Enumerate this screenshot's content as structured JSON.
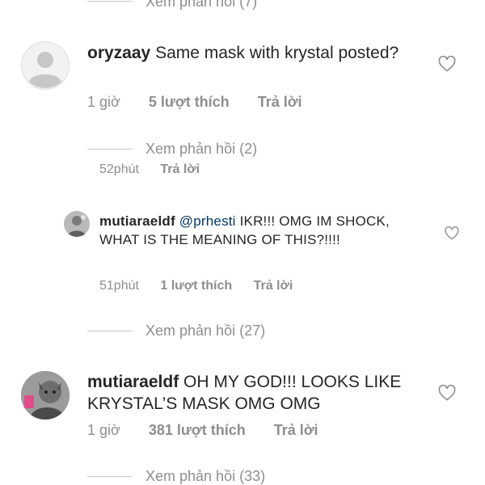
{
  "top_thread": {
    "view_replies": "Xem phản hồi (7)"
  },
  "comment1": {
    "username": "oryzaay",
    "text": "Same mask with krystal posted?",
    "time": "1 giờ",
    "likes": "5 lượt thích",
    "reply": "Trả lời",
    "view_replies": "Xem phản hồi (2)"
  },
  "reply_meta_above": {
    "time": "52phút",
    "reply": "Trả lời"
  },
  "reply1": {
    "username": "mutiaraeldf",
    "mention": "@prhesti",
    "text": "IKR!!! OMG IM SHOCK, WHAT IS THE MEANING OF THIS?!!!!",
    "time": "51phút",
    "likes": "1 lượt thích",
    "reply": "Trả lời",
    "view_replies": "Xem phản hồi (27)"
  },
  "comment2": {
    "username": "mutiaraeldf",
    "text": "OH MY GOD!!! LOOKS LIKE KRYSTAL’S MASK OMG OMG",
    "time": "1 giờ",
    "likes": "381 lượt thích",
    "reply": "Trả lời",
    "view_replies": "Xem phản hồi (33)"
  }
}
